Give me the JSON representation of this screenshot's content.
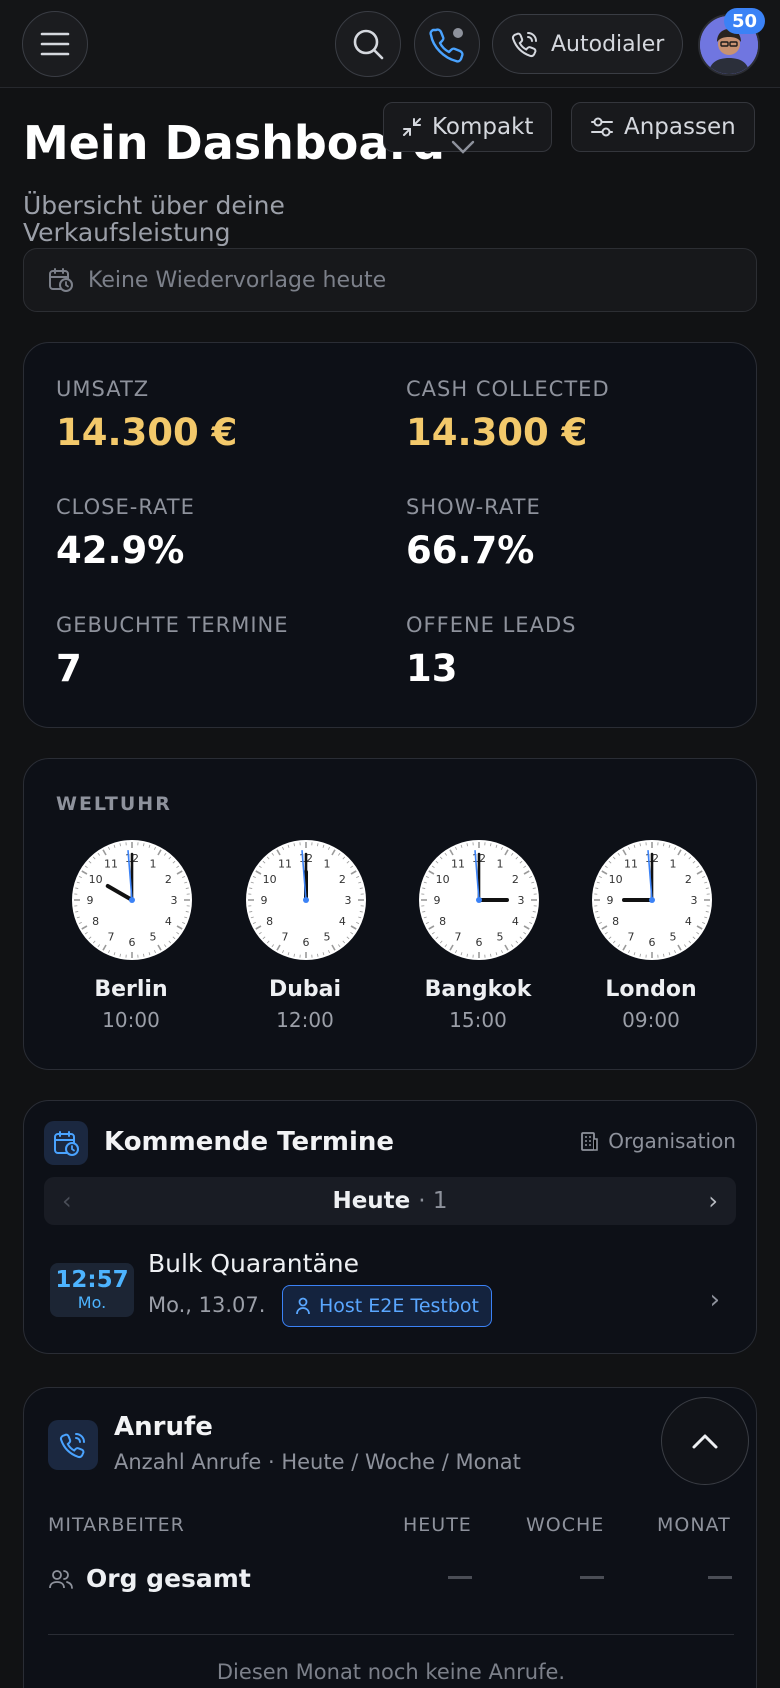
{
  "topbar": {
    "menu_icon": "menu-icon",
    "search_icon": "search-icon",
    "phone_icon": "phone-icon",
    "autodialer_label": "Autodialer",
    "avatar_badge": "50"
  },
  "header": {
    "title": "Mein Dashboard",
    "subtitle": "Übersicht über deine Verkaufsleistung",
    "compact_label": "Kompakt",
    "customize_label": "Anpassen"
  },
  "followup": {
    "text": "Keine Wiedervorlage heute"
  },
  "stats": [
    {
      "label": "UMSATZ",
      "value": "14.300 €",
      "accent": "#f3c96b"
    },
    {
      "label": "CASH COLLECTED",
      "value": "14.300 €",
      "accent": "#f3c96b"
    },
    {
      "label": "CLOSE-RATE",
      "value": "42.9%"
    },
    {
      "label": "SHOW-RATE",
      "value": "66.7%"
    },
    {
      "label": "GEBUCHTE TERMINE",
      "value": "7"
    },
    {
      "label": "OFFENE LEADS",
      "value": "13"
    }
  ],
  "world_clock": {
    "label": "WELTUHR",
    "clocks": [
      {
        "city": "Berlin",
        "time": "10:00",
        "hour": 10,
        "minute": 0
      },
      {
        "city": "Dubai",
        "time": "12:00",
        "hour": 12,
        "minute": 0
      },
      {
        "city": "Bangkok",
        "time": "15:00",
        "hour": 15,
        "minute": 0
      },
      {
        "city": "London",
        "time": "09:00",
        "hour": 9,
        "minute": 0
      }
    ]
  },
  "appointments": {
    "title": "Kommende Termine",
    "scope": "Organisation",
    "day_label": "Heute",
    "day_count": "· 1",
    "items": [
      {
        "time": "12:57",
        "weekday": "Mo.",
        "title": "Bulk Quarantäne",
        "date": "Mo., 13.07.",
        "host": "Host E2E Testbot"
      }
    ]
  },
  "calls": {
    "title": "Anrufe",
    "subtitle": "Anzahl Anrufe · Heute / Woche / Monat",
    "columns": [
      "MITARBEITER",
      "HEUTE",
      "WOCHE",
      "MONAT"
    ],
    "org_row_label": "Org gesamt",
    "empty_text": "Diesen Monat noch keine Anrufe."
  },
  "colors": {
    "accent_blue": "#3b82f6",
    "gold": "#f3c96b"
  }
}
